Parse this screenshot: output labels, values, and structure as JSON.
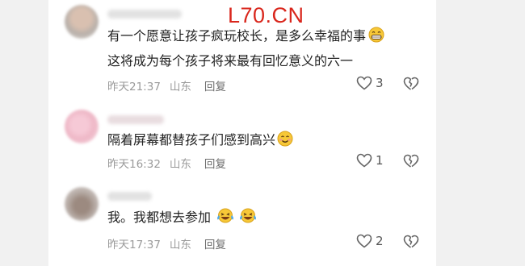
{
  "watermark": "L70.CN",
  "comments": [
    {
      "lines": [
        "有一个愿意让孩子疯玩校长，是多么幸福的事",
        "这将成为每个孩子将来最有回忆意义的六一"
      ],
      "emojis": [
        "grin-emoji"
      ],
      "time": "昨天21:37",
      "location": "山东",
      "reply": "回复",
      "likes": "3"
    },
    {
      "lines": [
        "隔着屏幕都替孩子们感到高兴"
      ],
      "emojis": [
        "smile-emoji"
      ],
      "time": "昨天16:32",
      "location": "山东",
      "reply": "回复",
      "likes": "1"
    },
    {
      "lines": [
        "我。我都想去参加"
      ],
      "emojis": [
        "tears-of-joy-emoji",
        "tears-of-joy-emoji"
      ],
      "time": "昨天17:37",
      "location": "山东",
      "reply": "回复",
      "likes": "2"
    }
  ],
  "icons": {
    "like": "heart-outline-icon",
    "dislike": "broken-heart-icon"
  }
}
